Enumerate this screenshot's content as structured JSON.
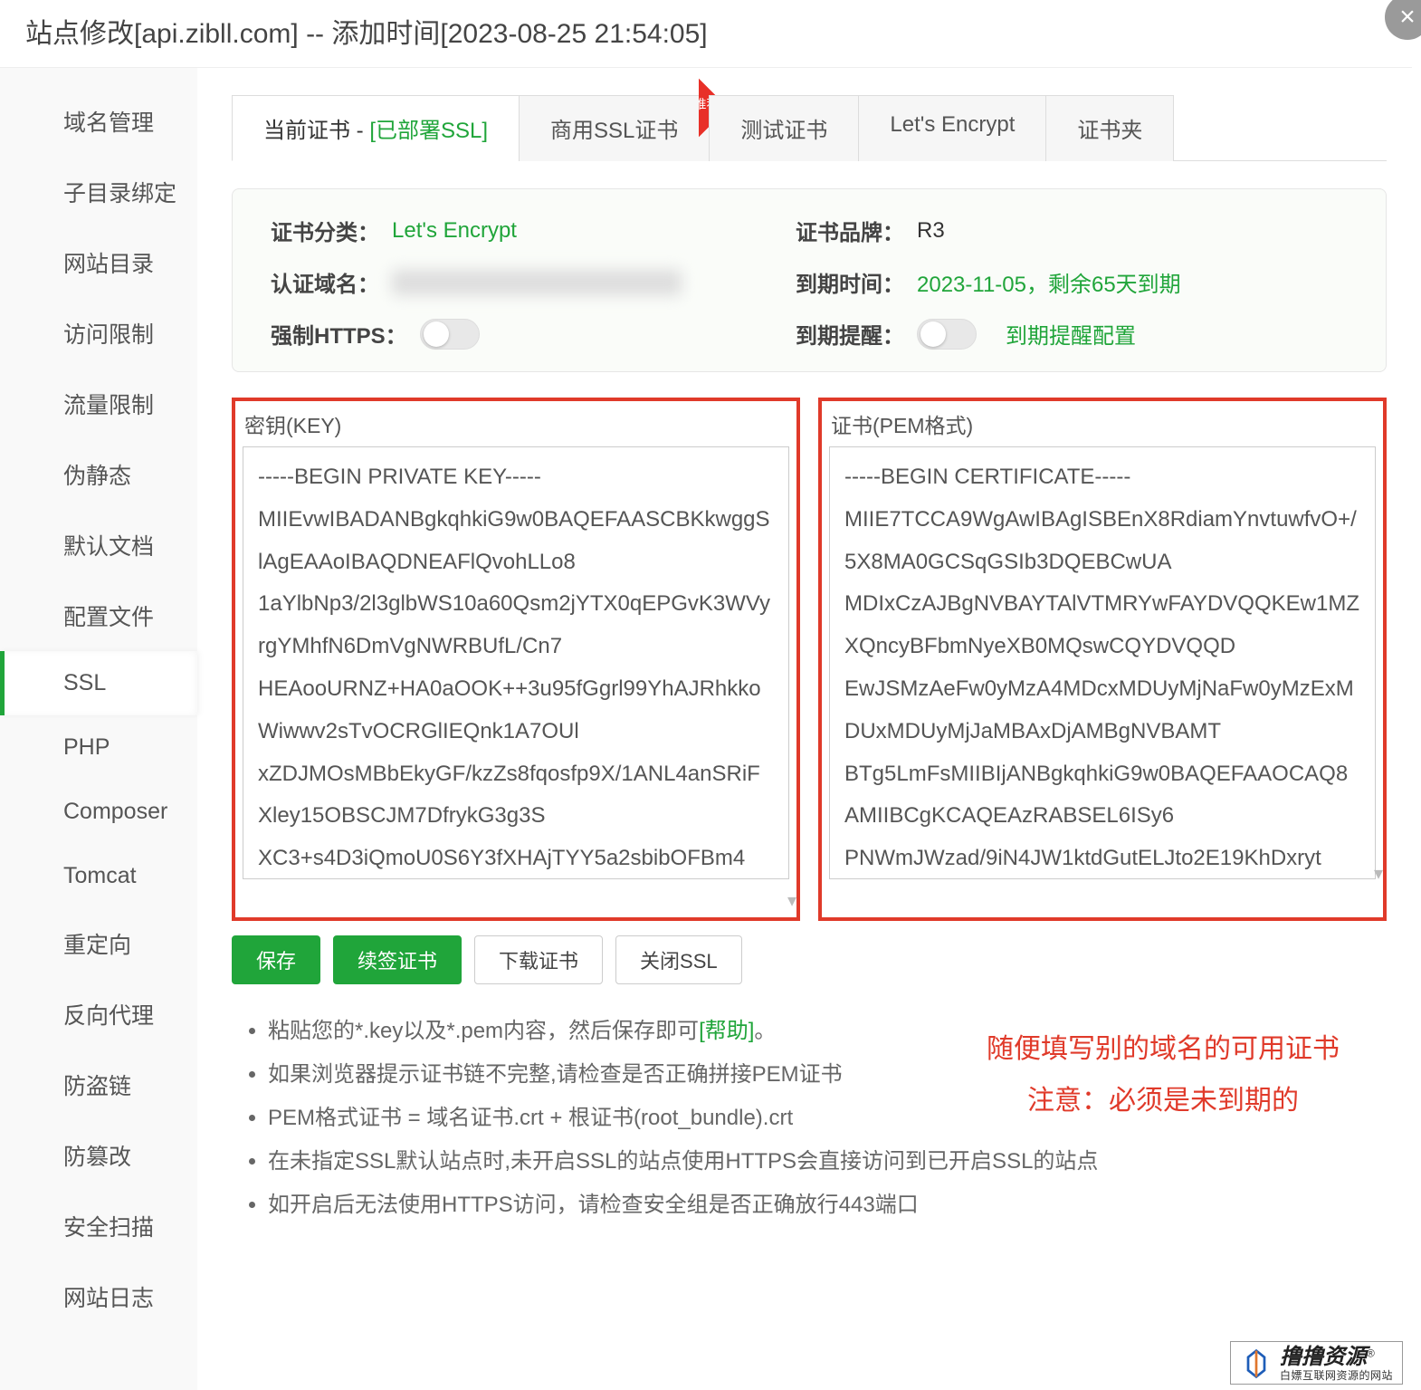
{
  "modal": {
    "title": "站点修改[api.zibll.com] -- 添加时间[2023-08-25 21:54:05]"
  },
  "sidebar": {
    "items": [
      {
        "label": "域名管理"
      },
      {
        "label": "子目录绑定"
      },
      {
        "label": "网站目录"
      },
      {
        "label": "访问限制"
      },
      {
        "label": "流量限制"
      },
      {
        "label": "伪静态"
      },
      {
        "label": "默认文档"
      },
      {
        "label": "配置文件"
      },
      {
        "label": "SSL"
      },
      {
        "label": "PHP"
      },
      {
        "label": "Composer"
      },
      {
        "label": "Tomcat"
      },
      {
        "label": "重定向"
      },
      {
        "label": "反向代理"
      },
      {
        "label": "防盗链"
      },
      {
        "label": "防篡改"
      },
      {
        "label": "安全扫描"
      },
      {
        "label": "网站日志"
      }
    ],
    "active_index": 8
  },
  "tabs": {
    "items": [
      {
        "prefix": "当前证书 - ",
        "suffix": "[已部署SSL]",
        "ribbon": ""
      },
      {
        "label": "商用SSL证书",
        "ribbon": "推荐"
      },
      {
        "label": "测试证书"
      },
      {
        "label": "Let's Encrypt"
      },
      {
        "label": "证书夹"
      }
    ],
    "active_index": 0
  },
  "info": {
    "cert_type_label": "证书分类：",
    "cert_type_value": "Let's Encrypt",
    "brand_label": "证书品牌：",
    "brand_value": "R3",
    "domain_label": "认证域名：",
    "expire_label": "到期时间：",
    "expire_value": "2023-11-05，剩余65天到期",
    "force_https_label": "强制HTTPS：",
    "expire_remind_label": "到期提醒：",
    "expire_remind_link": "到期提醒配置"
  },
  "cert": {
    "key_title": "密钥(KEY)",
    "key_value": "-----BEGIN PRIVATE KEY-----\nMIIEvwIBADANBgkqhkiG9w0BAQEFAASCBKkwggSlAgEAAoIBAQDNEAFlQvohLLo8\n1aYlbNp3/2l3glbWS10a60Qsm2jYTX0qEPGvK3WVyrgYMhfN6DmVgNWRBUfL/Cn7\nHEAooURNZ+HA0aOOK++3u95fGgrl99YhAJRhkkoWiwwv2sTvOCRGlIEQnk1A7OUl\nxZDJMOsMBbEkyGF/kzZs8fqosfp9X/1ANL4anSRiFXley15OBSCJM7DfrykG3g3S\nXC3+s4D3iQmoU0S6Y3fXHAjTYY5a2sbibOFBm4",
    "pem_title": "证书(PEM格式)",
    "pem_value": "-----BEGIN CERTIFICATE-----\nMIIE7TCCA9WgAwIBAgISBEnX8RdiamYnvtuwfvO+/5X8MA0GCSqGSIb3DQEBCwUA\nMDIxCzAJBgNVBAYTAlVTMRYwFAYDVQQKEw1MZXQncyBFbmNyeXB0MQswCQYDVQQD\nEwJSMzAeFw0yMzA4MDcxMDUyMjNaFw0yMzExMDUxMDUyMjJaMBAxDjAMBgNVBAMT\nBTg5LmFsMIIBIjANBgkqhkiG9w0BAQEFAAOCAQ8AMIIBCgKCAQEAzRABSEL6ISy6\nPNWmJWzad/9iN4JW1ktdGutELJto2E19KhDxryt"
  },
  "buttons": {
    "save": "保存",
    "renew": "续签证书",
    "download": "下载证书",
    "close_ssl": "关闭SSL"
  },
  "tips": {
    "item1_prefix": "粘贴您的*.key以及*.pem内容，然后保存即可",
    "item1_help": "[帮助]",
    "item1_suffix": "。",
    "item2": "如果浏览器提示证书链不完整,请检查是否正确拼接PEM证书",
    "item3": "PEM格式证书 = 域名证书.crt + 根证书(root_bundle).crt",
    "item4": "在未指定SSL默认站点时,未开启SSL的站点使用HTTPS会直接访问到已开启SSL的站点",
    "item5": "如开启后无法使用HTTPS访问，请检查安全组是否正确放行443端口"
  },
  "annotation": {
    "line1": "随便填写别的域名的可用证书",
    "line2": "注意：必须是未到期的"
  },
  "watermark": {
    "main": "撸撸资源",
    "sub": "白嫖互联网资源的网站"
  }
}
